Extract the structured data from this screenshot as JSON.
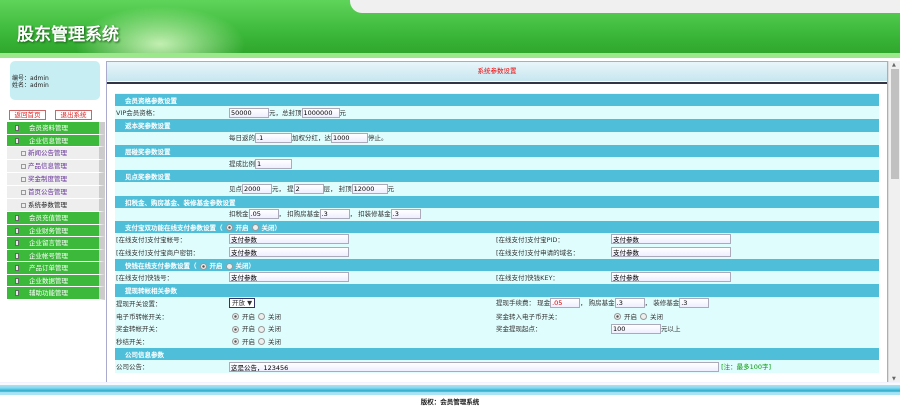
{
  "header": {
    "title": "股东管理系统"
  },
  "user": {
    "id_label": "编号：",
    "id": "admin",
    "name_label": "姓名：",
    "name": "admin"
  },
  "buttons": {
    "home": "返回首页",
    "logout": "退出系统"
  },
  "menu": [
    {
      "label": "会员资料管理",
      "sub": []
    },
    {
      "label": "企业信息管理",
      "sub": [
        "新闻公告管理",
        "产品信息管理",
        "奖金制度管理",
        "首页公告管理",
        "系统参数管理"
      ]
    },
    {
      "label": "会员充值管理",
      "sub": []
    },
    {
      "label": "企业财务管理",
      "sub": []
    },
    {
      "label": "企业留言管理",
      "sub": []
    },
    {
      "label": "企业帐号管理",
      "sub": []
    },
    {
      "label": "产品订单管理",
      "sub": []
    },
    {
      "label": "企业数据管理",
      "sub": []
    },
    {
      "label": "辅助功能管理",
      "sub": []
    }
  ],
  "page_title": "系统参数设置",
  "form": {
    "s1": "会员资格参数设置",
    "vip_label": "VIP会员资格：",
    "vip": "50000",
    "yuan": "元，总封顶",
    "cap": "1000000",
    "yuan2": "元",
    "s2": "返本奖参数设置",
    "r2a": "每日返的",
    "r2v1": ".1",
    "r2b": "加权分红，达",
    "r2v2": "1000",
    "r2c": "停止。",
    "s3": "层碰奖参数设置",
    "r3a": "提成比例",
    "r3v": "1",
    "s4": "见点奖参数设置",
    "r4a": "见点",
    "r4v1": "2000",
    "r4b": "元，  提",
    "r4v2": "2",
    "r4c": "层，  封顶",
    "r4v3": "12000",
    "r4d": "元",
    "s5": "扣税金、购房基金、装修基金参数设置",
    "r5a": "扣税金",
    "r5v1": ".05",
    "r5b": "，  扣购房基金",
    "r5v2": ".3",
    "r5c": "，  扣装修基金",
    "r5v3": ".3",
    "s6": "支付宝双功能在线支付参数设置（",
    "on": "开启",
    "off": "关闭",
    "close_paren": "）",
    "alipay_acc_label": "[在线支付]支付宝帐号：",
    "alipay_acc": "支付参数",
    "alipay_pid_label": "[在线支付]支付宝PID：",
    "alipay_pid": "支付参数",
    "alipay_key_label": "[在线支付]支付宝商户密钥：",
    "alipay_key": "支付参数",
    "domain_label": "[在线支付]支付申请的域名：",
    "domain": "支付参数",
    "s7": "快钱在线支付参数设置（",
    "kq_acc_label": "[在线支付]快钱号：",
    "kq_acc": "支付参数",
    "kq_key_label": "[在线支付]快钱KEY：",
    "kq_key": "支付参数",
    "s8": "提现转帐相关参数",
    "wd_switch_label": "提现开关设置：",
    "wd_switch": "开放",
    "fee_label": "提现手续费：  现金",
    "fee1": ".05",
    "fee_b": "，  购房基金",
    "fee2": ".3",
    "fee_c": "，  装修基金",
    "fee3": ".3",
    "ecoin_label": "电子币转帐开关：",
    "bonus_to_ecoin_label": "奖金转入电子币开关：",
    "bonus_transfer_label": "奖金转帐开关：",
    "min_wd_label": "奖金提现起点：",
    "min_wd": "100",
    "min_wd_unit": "元以上",
    "settle_label": "秒结开关：",
    "s9": "公司信息参数",
    "notice_label": "公司公告：",
    "notice": "这是公告，123456",
    "notice_hint": "[注：最多100字]"
  },
  "footer": "版权：会员管理系统"
}
